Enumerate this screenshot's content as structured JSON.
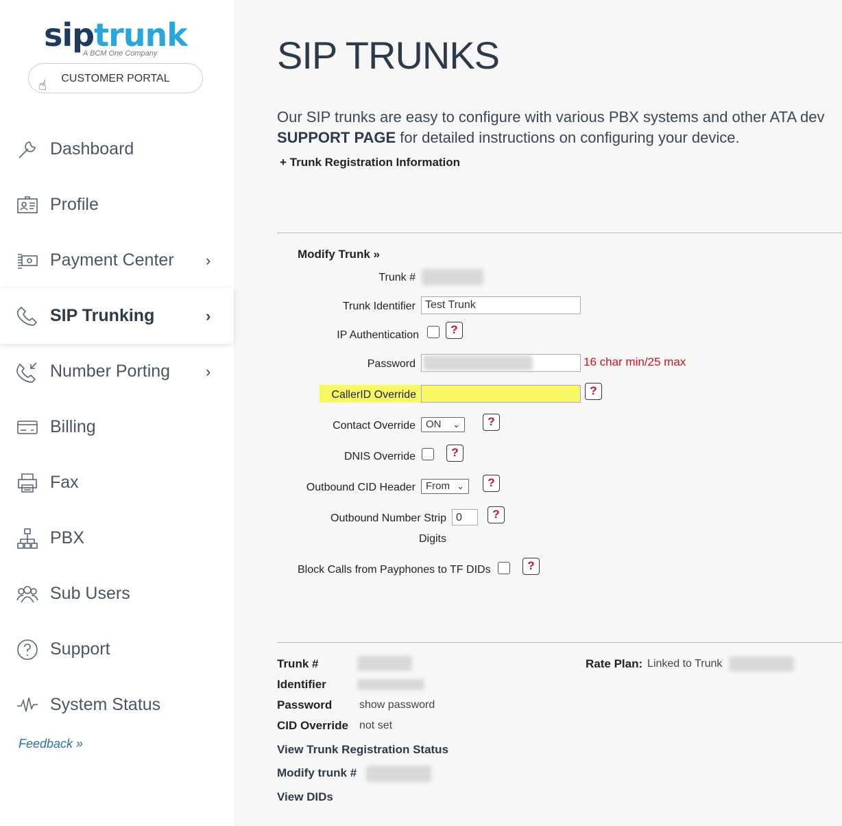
{
  "brand": {
    "logo_sip": "sip",
    "logo_trunk": "trunk",
    "logo_tagline": "A BCM One Company",
    "portal_label": "CUSTOMER PORTAL"
  },
  "nav": {
    "items": [
      {
        "label": "Dashboard",
        "icon": "wrench-icon"
      },
      {
        "label": "Profile",
        "icon": "id-card-icon"
      },
      {
        "label": "Payment Center",
        "icon": "money-icon"
      },
      {
        "label": "SIP Trunking",
        "icon": "phone-icon"
      },
      {
        "label": "Number Porting",
        "icon": "phone-incoming-icon"
      },
      {
        "label": "Billing",
        "icon": "credit-card-icon"
      },
      {
        "label": "Fax",
        "icon": "printer-icon"
      },
      {
        "label": "PBX",
        "icon": "network-icon"
      },
      {
        "label": "Sub Users",
        "icon": "users-icon"
      },
      {
        "label": "Support",
        "icon": "question-circle-icon"
      },
      {
        "label": "System Status",
        "icon": "pulse-icon"
      }
    ],
    "chevron": "›",
    "feedback": "Feedback »"
  },
  "main": {
    "title": "SIP TRUNKS",
    "intro_line1": "Our SIP trunks are easy to configure with various PBX systems and other ATA dev",
    "intro_support": "SUPPORT PAGE",
    "intro_line2_rest": " for detailed instructions on configuring your device.",
    "reg_info": "+  Trunk Registration Information"
  },
  "form": {
    "title": "Modify Trunk »",
    "trunk_num_label": "Trunk #",
    "identifier_label": "Trunk Identifier",
    "identifier_value": "Test Trunk",
    "ip_auth_label": "IP Authentication",
    "password_label": "Password",
    "password_hint": "16 char min/25 max",
    "callerid_label": "CallerID Override",
    "contact_label": "Contact Override",
    "contact_value": "ON",
    "dnis_label": "DNIS Override",
    "cid_header_label": "Outbound CID Header",
    "cid_header_value": "From",
    "strip_label": "Outbound Number Strip",
    "strip_label2": "Digits",
    "strip_value": "0",
    "payphone_label": "Block Calls from Payphones to TF DIDs",
    "help": "?"
  },
  "summary": {
    "trunk_label": "Trunk #",
    "identifier_label": "Identifier",
    "password_label": "Password",
    "password_value": "show password",
    "cid_label": "CID Override",
    "cid_value": "not set",
    "rate_label": "Rate Plan:",
    "rate_value": "Linked to Trunk",
    "link_status": "View Trunk Registration Status",
    "link_modify": "Modify trunk #",
    "link_dids": "View DIDs"
  }
}
